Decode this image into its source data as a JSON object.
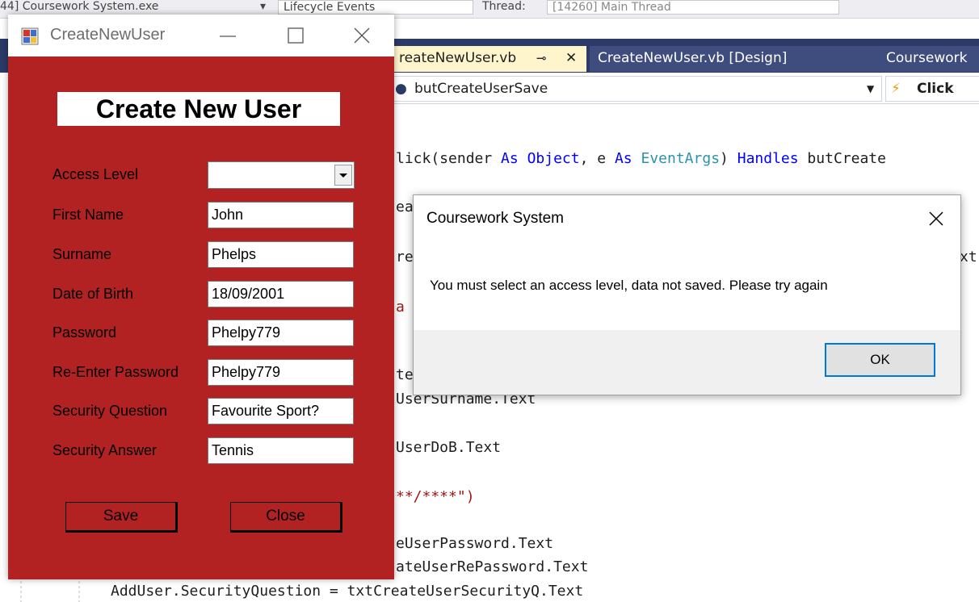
{
  "ide": {
    "topbar": {
      "process": "44] Coursework System.exe",
      "lifecycle": "Lifecycle Events",
      "thread_label": "Thread:",
      "thread_value": "[14260] Main Thread"
    },
    "tabs": {
      "active": "reateNewUser.vb",
      "design": "CreateNewUser.vb [Design]",
      "third": "Coursework"
    },
    "nav": {
      "member": "butCreateUserSave",
      "event": "Click"
    },
    "code_lines": {
      "l1_a": "lick(sender ",
      "l1_as1": "As",
      "l1_obj": "Object",
      "l1_b": ", e ",
      "l1_as2": "As",
      "l1_evt": "EventArgs",
      "l1_c": ") ",
      "l1_handles": "Handles",
      "l1_d": " butCreate",
      "l2": "ea",
      "l3": "re",
      "l3_right": "xt",
      "l4": "a",
      "l5": "te",
      "l6": "UserSurname.Text",
      "l7": "UserDoB.Text",
      "l8": "**/****\")",
      "l9": "eUserPassword.Text",
      "l10": "ateUserRePassword.Text",
      "l11": "AddUser.SecurityQuestion = txtCreateUserSecurityQ.Text"
    }
  },
  "form": {
    "title": "CreateNewUser",
    "heading": "Create New User",
    "labels": {
      "access_level": "Access Level",
      "first_name": "First Name",
      "surname": "Surname",
      "dob": "Date of Birth",
      "password": "Password",
      "repassword": "Re-Enter Password",
      "security_q": "Security Question",
      "security_a": "Security Answer"
    },
    "values": {
      "access_level": "",
      "first_name": "John",
      "surname": "Phelps",
      "dob": "18/09/2001",
      "password": "Phelpy779",
      "repassword": "Phelpy779",
      "security_q": "Favourite Sport?",
      "security_a": "Tennis"
    },
    "buttons": {
      "save": "Save",
      "close": "Close"
    },
    "colors": {
      "background": "#b22222"
    }
  },
  "msgbox": {
    "title": "Coursework System",
    "message": "You must select an access level, data not saved. Please try again",
    "ok": "OK"
  }
}
